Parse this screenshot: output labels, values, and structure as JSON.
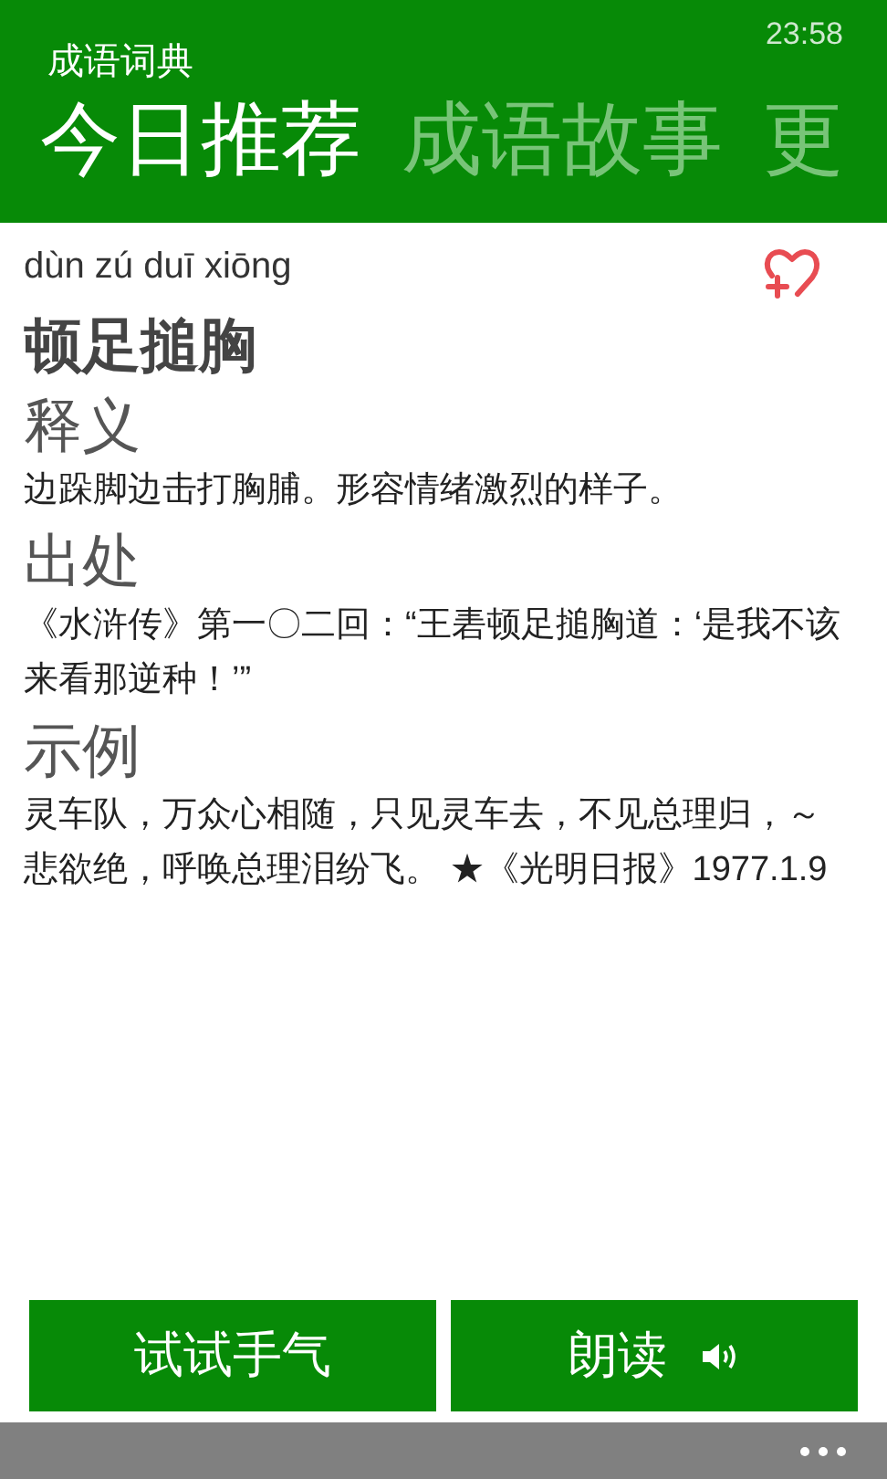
{
  "status_bar": {
    "time": "23:58"
  },
  "app_title": "成语词典",
  "tabs": [
    {
      "label": "今日推荐",
      "selected": true
    },
    {
      "label": "成语故事",
      "selected": false
    },
    {
      "label": "更",
      "selected": false
    }
  ],
  "idiom": {
    "pinyin": "dùn zú duī xiōng",
    "word": "顿足搥胸"
  },
  "sections": [
    {
      "heading": "释义",
      "text": "边跺脚边击打胸脯。形容情绪激烈的样子。"
    },
    {
      "heading": "出处",
      "text": "《水浒传》第一〇二回：“王砉顿足搥胸道：‘是我不该来看那逆种！’”"
    },
    {
      "heading": "示例",
      "text": "灵车队，万众心相随，只见灵车去，不见总理归，～悲欲绝，呼唤总理泪纷飞。 ★《光明日报》1977.1.9"
    }
  ],
  "buttons": [
    {
      "label": "试试手气",
      "kind": "plain"
    },
    {
      "label": "朗读",
      "kind": "speak"
    }
  ]
}
